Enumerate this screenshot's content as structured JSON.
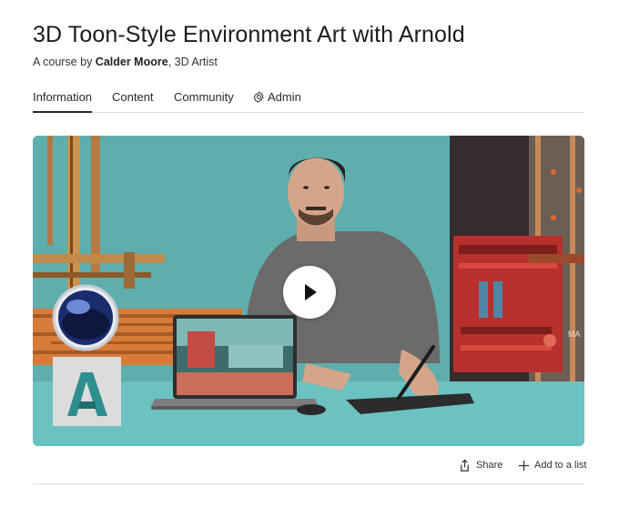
{
  "course": {
    "title": "3D Toon-Style Environment Art with Arnold",
    "byline_prefix": "A course by ",
    "author": "Calder Moore",
    "byline_suffix": ", 3D Artist"
  },
  "tabs": [
    {
      "label": "Information",
      "active": true
    },
    {
      "label": "Content",
      "active": false
    },
    {
      "label": "Community",
      "active": false
    },
    {
      "label": "Admin",
      "active": false,
      "icon": "gear-icon"
    }
  ],
  "video": {
    "play_icon": "play-icon",
    "screen_text": "MA",
    "accent_teal": "#5faeae",
    "accent_red": "#c0392b"
  },
  "actions": {
    "share_label": "Share",
    "share_icon": "share-icon",
    "add_label": "Add to a list",
    "add_icon": "plus-icon"
  }
}
